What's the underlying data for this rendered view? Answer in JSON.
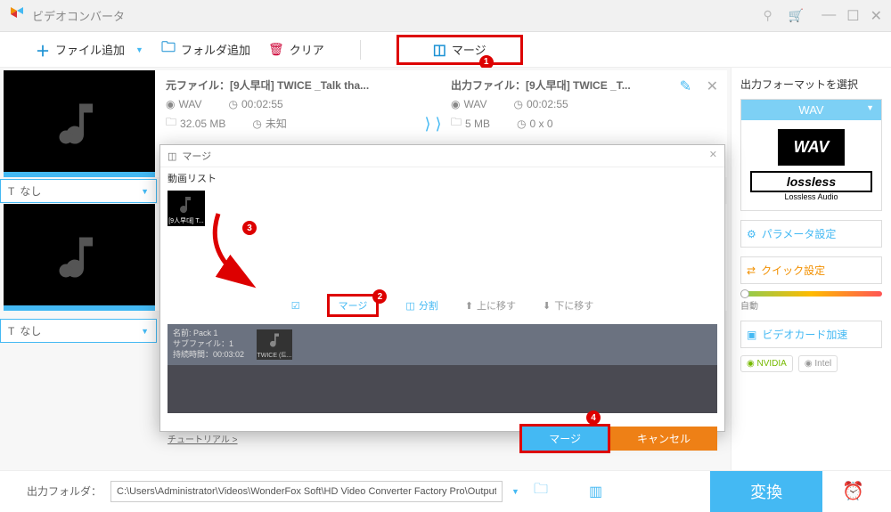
{
  "titlebar": {
    "title": "ビデオコンバータ"
  },
  "toolbar": {
    "add_file": "ファイル追加",
    "add_folder": "フォルダ追加",
    "clear": "クリア",
    "merge": "マージ"
  },
  "file1": {
    "src_label": "元ファイル：[9人早대] TWICE _Talk tha...",
    "out_label": "出力ファイル：[9人早대] TWICE _T...",
    "format": "WAV",
    "duration": "00:02:55",
    "size": "32.05 MB",
    "info2": "未知",
    "out_size": "5 MB",
    "out_res": "0 x 0",
    "dropdown": "なし"
  },
  "file2": {
    "dropdown": "なし"
  },
  "right": {
    "title": "出力フォーマットを選択",
    "format": "WAV",
    "wav_text": "WAV",
    "lossless": "lossless",
    "lossless_sub": "Lossless Audio",
    "param_btn": "パラメータ設定",
    "quick_btn": "クイック設定",
    "auto": "自動",
    "gpu_btn": "ビデオカード加速",
    "nvidia": "NVIDIA",
    "intel": "Intel"
  },
  "modal": {
    "title": "マージ",
    "video_list_label": "動画リスト",
    "thumb_label": "[9人早대] T...",
    "merge_btn": "マージ",
    "split_btn": "分割",
    "move_up": "上に移す",
    "move_down": "下に移す",
    "pack_name": "名前: Pack 1",
    "pack_sub": "サブファイル：1",
    "pack_duration": "持続時間：00:03:02",
    "pack_thumb": "TWICE (트...",
    "tutorial": "チュートリアル >",
    "confirm": "マージ",
    "cancel": "キャンセル"
  },
  "bottom": {
    "label": "出力フォルダ：",
    "path": "C:\\Users\\Administrator\\Videos\\WonderFox Soft\\HD Video Converter Factory Pro\\OutputVideo\\",
    "convert": "変換"
  },
  "badges": {
    "b1": "1",
    "b2": "2",
    "b3": "3",
    "b4": "4"
  }
}
